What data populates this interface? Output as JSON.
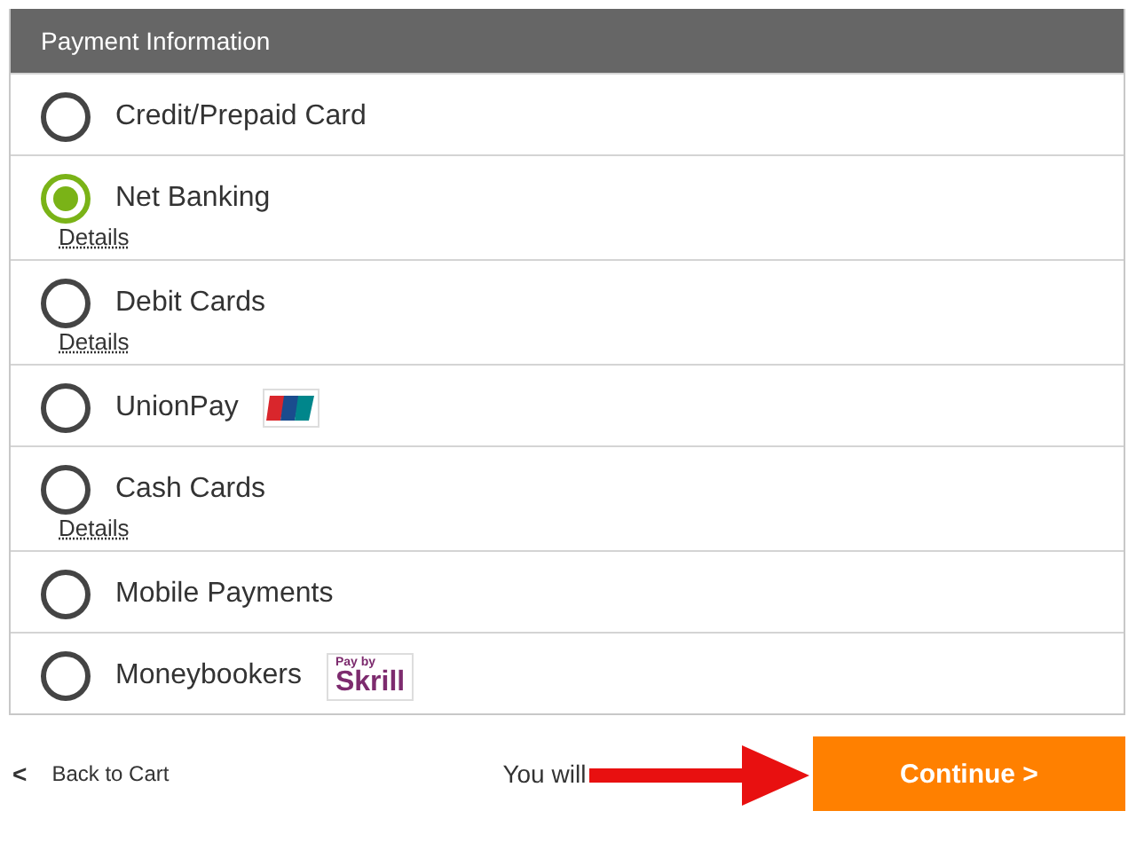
{
  "panel": {
    "title": "Payment Information"
  },
  "options": [
    {
      "label": "Credit/Prepaid Card",
      "selected": false
    },
    {
      "label": "Net Banking",
      "selected": true,
      "details": "Details"
    },
    {
      "label": "Debit Cards",
      "selected": false,
      "details": "Details"
    },
    {
      "label": "UnionPay",
      "selected": false,
      "logo": {
        "kind": "unionpay"
      }
    },
    {
      "label": "Cash Cards",
      "selected": false,
      "details": "Details"
    },
    {
      "label": "Mobile Payments",
      "selected": false
    },
    {
      "label": "Moneybookers",
      "selected": false,
      "logo": {
        "kind": "skrill",
        "top": "Pay by",
        "main": "Skrill"
      }
    }
  ],
  "footer": {
    "back": "Back to Cart",
    "back_icon": "<",
    "note": "You will",
    "continue": "Continue >"
  }
}
